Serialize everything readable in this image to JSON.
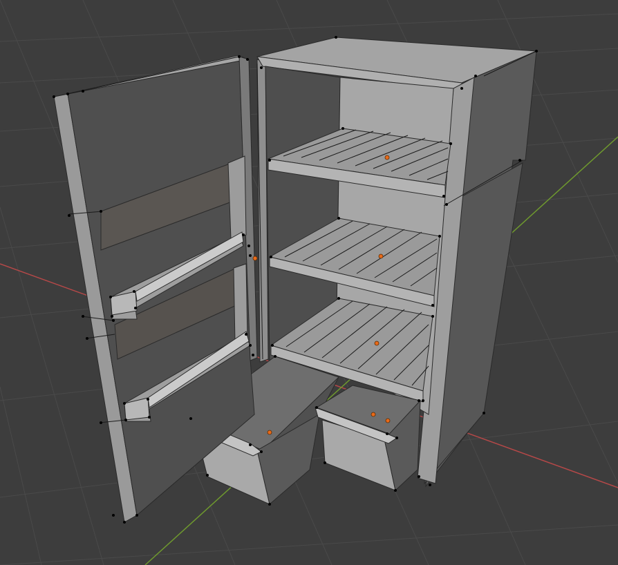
{
  "viewport": {
    "background": "#3d3d3d",
    "grid_color": "#4a4a4a",
    "axis_x_color": "#b54848",
    "axis_y_color": "#6f9a2e",
    "mode": "edit",
    "object": "refrigerator",
    "shelf_count": 3,
    "door_bin_count": 2,
    "drawer_count": 2
  },
  "colors": {
    "mesh_light": "#a9a9a9",
    "mesh_mid": "#8c8c8c",
    "mesh_dark": "#565656",
    "mesh_interior": "#6a6a6a",
    "mesh_back": "#a4a4a4",
    "vertex": "#000000",
    "origin_marker": "#e86a1a"
  }
}
